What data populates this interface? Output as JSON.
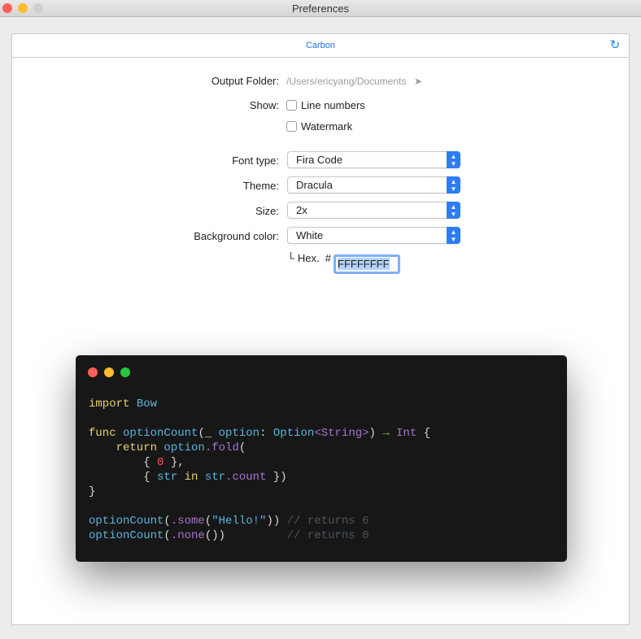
{
  "window": {
    "title": "Preferences",
    "colors": {
      "close": "#fe5f57",
      "minimize": "#febc2e",
      "zoom": "#cfcfcf"
    }
  },
  "header": {
    "tab": "Carbon",
    "refresh_icon": "refresh-icon"
  },
  "form": {
    "output_folder_label": "Output Folder:",
    "output_folder_value": "/Users/ericyang/Documents",
    "output_folder_arrow": "➤",
    "show_label": "Show:",
    "line_numbers": {
      "label": "Line numbers",
      "checked": false
    },
    "watermark": {
      "label": "Watermark",
      "checked": false
    },
    "font_type_label": "Font type:",
    "font_type_value": "Fira Code",
    "theme_label": "Theme:",
    "theme_value": "Dracula",
    "size_label": "Size:",
    "size_value": "2x",
    "bg_label": "Background color:",
    "bg_value": "White",
    "hex_prefix": "└ Hex.  #",
    "hex_value": "FFFFFFFF"
  },
  "preview": {
    "code_lines": [
      [
        [
          "kw",
          "import "
        ],
        [
          "id",
          "Bow"
        ]
      ],
      [],
      [
        [
          "kw",
          "func "
        ],
        [
          "id",
          "optionCount"
        ],
        [
          "pl",
          "(_ "
        ],
        [
          "id",
          "option"
        ],
        [
          "pl",
          ": "
        ],
        [
          "id",
          "Option"
        ],
        [
          "pu",
          "<String>"
        ],
        [
          "pl",
          ") "
        ],
        [
          "gr",
          "→ "
        ],
        [
          "pu",
          "Int"
        ],
        [
          "pl",
          " {"
        ]
      ],
      [
        [
          "kw",
          "    return "
        ],
        [
          "id",
          "option"
        ],
        [
          "pu",
          ".fold"
        ],
        [
          "pl",
          "("
        ]
      ],
      [
        [
          "pl",
          "        { "
        ],
        [
          "nu",
          "0"
        ],
        [
          "pl",
          " },"
        ]
      ],
      [
        [
          "pl",
          "        { "
        ],
        [
          "id",
          "str "
        ],
        [
          "kw",
          "in "
        ],
        [
          "id",
          "str"
        ],
        [
          "pu",
          ".count"
        ],
        [
          "pl",
          " })"
        ]
      ],
      [
        [
          "pl",
          "}"
        ]
      ],
      [],
      [
        [
          "id",
          "optionCount"
        ],
        [
          "pl",
          "("
        ],
        [
          "pu",
          ".some"
        ],
        [
          "pl",
          "("
        ],
        [
          "id",
          "\"Hello!\""
        ],
        [
          "pl",
          "))"
        ],
        [
          "cm",
          " // returns 6"
        ]
      ],
      [
        [
          "id",
          "optionCount"
        ],
        [
          "pl",
          "("
        ],
        [
          "pu",
          ".none"
        ],
        [
          "pl",
          "())"
        ],
        [
          "cm",
          "         // returns 0"
        ]
      ]
    ]
  }
}
